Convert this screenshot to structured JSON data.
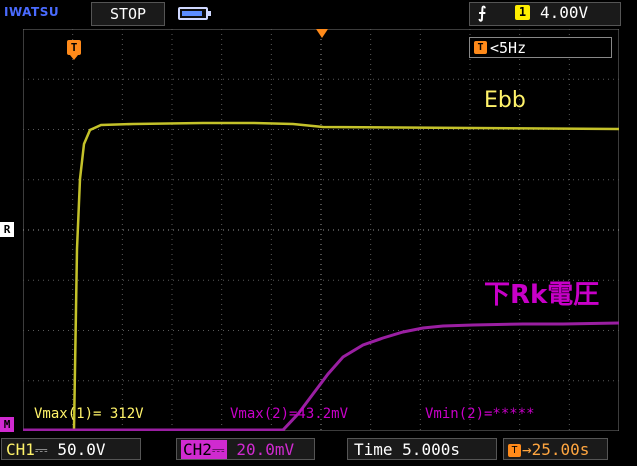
{
  "header": {
    "brand": "IWATSU",
    "run_state": "STOP",
    "trigger_edge_icon": "rising-edge-icon",
    "trigger_source": "1",
    "trigger_level": "4.00V"
  },
  "trigger_info": {
    "badge": "T",
    "frequency": "<5Hz"
  },
  "markers": {
    "trigger_position": "T",
    "reference": "R",
    "channel2_ground": "M"
  },
  "traces": {
    "ch1": {
      "label": "Ebb",
      "color": "#c4c22a"
    },
    "ch2": {
      "label": "下Rk電圧",
      "color": "#9a1fa2"
    }
  },
  "measurements": {
    "vmax1": "Vmax(1)= 312V",
    "vmax2": "Vmax(2)=43.2mV",
    "vmin2": "Vmin(2)=*****"
  },
  "footer": {
    "ch1_tag": "CH1",
    "ch1_coupling": "⎓",
    "ch1_scale": "50.0V",
    "ch2_tag": "CH2",
    "ch2_coupling": "⎓",
    "ch2_scale": "20.0mV",
    "time_label": "Time",
    "time_scale": "5.000s",
    "h_position": "25.00s"
  }
}
